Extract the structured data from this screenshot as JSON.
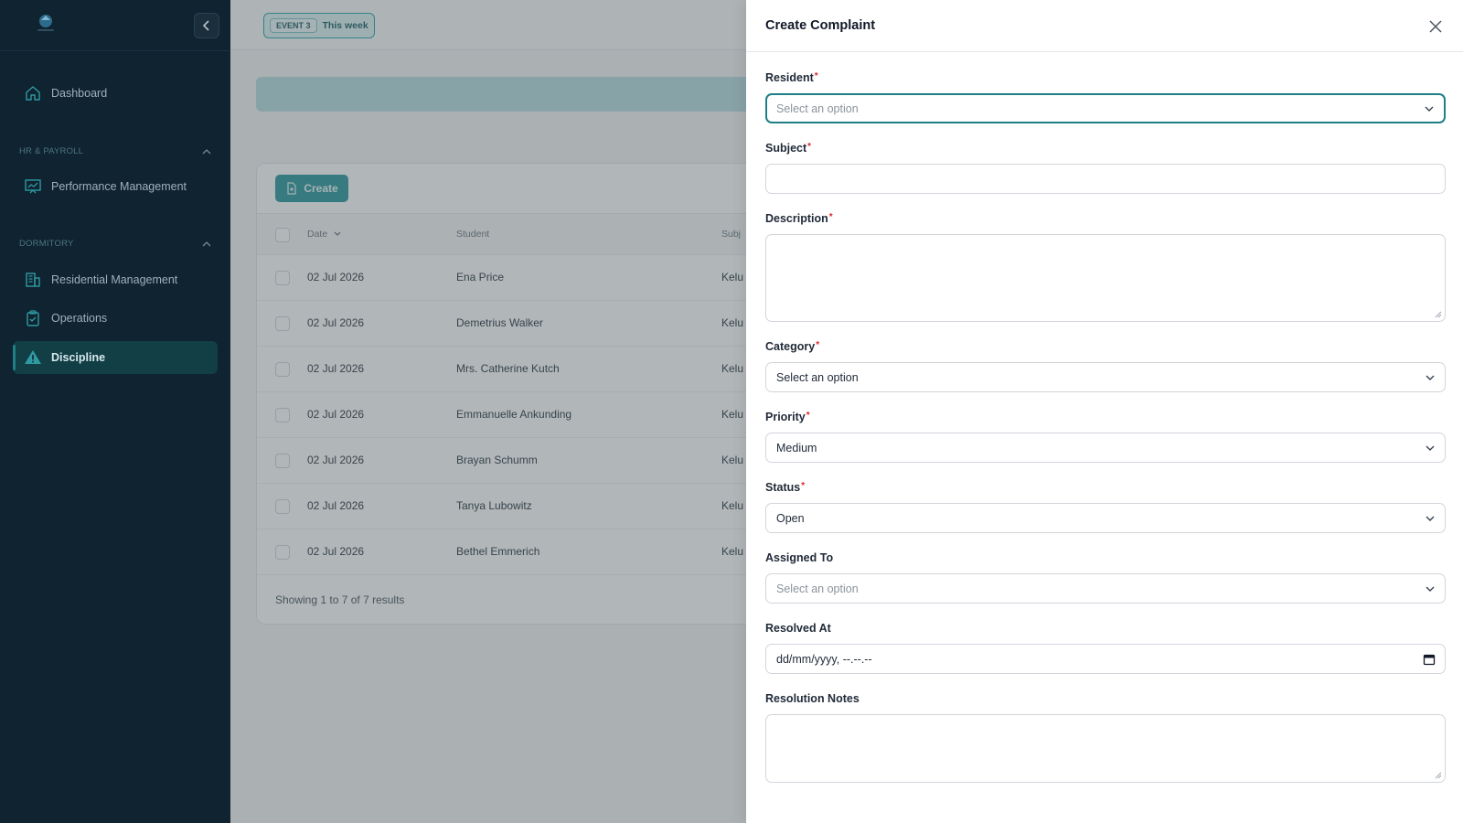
{
  "sidebar": {
    "logo_text": "",
    "items": [
      {
        "label": "Dashboard",
        "icon": "home-icon"
      },
      {
        "label": "Performance Management",
        "icon": "chart-board-icon"
      },
      {
        "label": "Residential Management",
        "icon": "building-icon"
      },
      {
        "label": "Operations",
        "icon": "clipboard-check-icon"
      },
      {
        "label": "Discipline",
        "icon": "warning-icon",
        "active": true
      }
    ],
    "groups": [
      {
        "label": "HR & PAYROLL"
      },
      {
        "label": "DORMITORY"
      }
    ]
  },
  "topbar": {
    "event_tag": "EVENT 3",
    "event_period": "This week"
  },
  "table": {
    "create_label": "Create",
    "columns": [
      "Date",
      "Student",
      "Subj"
    ],
    "rows": [
      {
        "date": "02 Jul 2026",
        "student": "Ena Price",
        "subject": "Kelu"
      },
      {
        "date": "02 Jul 2026",
        "student": "Demetrius Walker",
        "subject": "Kelu"
      },
      {
        "date": "02 Jul 2026",
        "student": "Mrs. Catherine Kutch",
        "subject": "Kelu"
      },
      {
        "date": "02 Jul 2026",
        "student": "Emmanuelle Ankunding",
        "subject": "Kelu"
      },
      {
        "date": "02 Jul 2026",
        "student": "Brayan Schumm",
        "subject": "Kelu"
      },
      {
        "date": "02 Jul 2026",
        "student": "Tanya Lubowitz",
        "subject": "Kelu"
      },
      {
        "date": "02 Jul 2026",
        "student": "Bethel Emmerich",
        "subject": "Kelu"
      }
    ],
    "footer": "Showing 1 to 7 of 7 results"
  },
  "modal": {
    "title": "Create Complaint",
    "required_mark": "*",
    "fields": {
      "resident": {
        "label": "Resident",
        "placeholder": "Select an option"
      },
      "subject": {
        "label": "Subject",
        "value": ""
      },
      "description": {
        "label": "Description",
        "value": ""
      },
      "category": {
        "label": "Category",
        "value": "Select an option"
      },
      "priority": {
        "label": "Priority",
        "value": "Medium"
      },
      "status": {
        "label": "Status",
        "value": "Open"
      },
      "assigned_to": {
        "label": "Assigned To",
        "placeholder": "Select an option"
      },
      "resolved_at": {
        "label": "Resolved At",
        "placeholder": "dd/mm/yyyy, --.--.--"
      },
      "resolution_notes": {
        "label": "Resolution Notes",
        "value": ""
      }
    }
  },
  "colors": {
    "sidebar_bg": "#0f2330",
    "accent": "#2d9aa0",
    "focus_border": "#1e7f86",
    "required": "#dc2626"
  }
}
